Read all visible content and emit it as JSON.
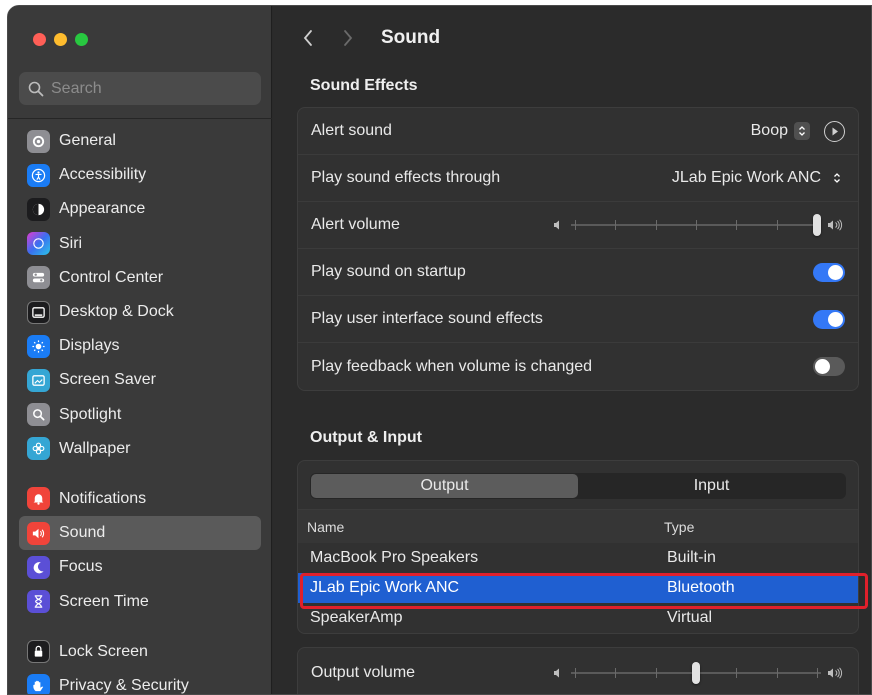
{
  "window": {
    "title": "Sound"
  },
  "search": {
    "placeholder": "Search"
  },
  "sidebar": {
    "items": [
      {
        "label": "General",
        "icon": "gear-icon",
        "color": "#8e8e93"
      },
      {
        "label": "Accessibility",
        "icon": "accessibility-icon",
        "color": "#1a7cf5"
      },
      {
        "label": "Appearance",
        "icon": "appearance-icon",
        "color": "#1c1c1e"
      },
      {
        "label": "Siri",
        "icon": "siri-icon",
        "color": "#6b3fd6"
      },
      {
        "label": "Control Center",
        "icon": "control-center-icon",
        "color": "#8e8e93"
      },
      {
        "label": "Desktop & Dock",
        "icon": "dock-icon",
        "color": "#1c1c1e"
      },
      {
        "label": "Displays",
        "icon": "sun-icon",
        "color": "#1a7cf5"
      },
      {
        "label": "Screen Saver",
        "icon": "screensaver-icon",
        "color": "#35a6d4"
      },
      {
        "label": "Spotlight",
        "icon": "magnifier-icon",
        "color": "#8e8e93"
      },
      {
        "label": "Wallpaper",
        "icon": "flower-icon",
        "color": "#35a6d4"
      },
      {
        "label": "Notifications",
        "icon": "bell-icon",
        "color": "#f0443a"
      },
      {
        "label": "Sound",
        "icon": "speaker-icon",
        "color": "#f0443a"
      },
      {
        "label": "Focus",
        "icon": "moon-icon",
        "color": "#5b4fd6"
      },
      {
        "label": "Screen Time",
        "icon": "hourglass-icon",
        "color": "#5b4fd6"
      },
      {
        "label": "Lock Screen",
        "icon": "lock-icon",
        "color": "#1c1c1e"
      },
      {
        "label": "Privacy & Security",
        "icon": "hand-icon",
        "color": "#1a7cf5"
      }
    ]
  },
  "sound_effects": {
    "title": "Sound Effects",
    "alert_sound": {
      "label": "Alert sound",
      "value": "Boop"
    },
    "play_through": {
      "label": "Play sound effects through",
      "value": "JLab Epic Work ANC"
    },
    "alert_volume": {
      "label": "Alert volume",
      "level": 1.0
    },
    "startup": {
      "label": "Play sound on startup",
      "on": true
    },
    "ui_effects": {
      "label": "Play user interface sound effects",
      "on": true
    },
    "feedback": {
      "label": "Play feedback when volume is changed",
      "on": false
    }
  },
  "output_input": {
    "title": "Output & Input",
    "tabs": [
      {
        "label": "Output",
        "active": true
      },
      {
        "label": "Input",
        "active": false
      }
    ],
    "columns": {
      "name": "Name",
      "type": "Type"
    },
    "devices": [
      {
        "name": "MacBook Pro Speakers",
        "type": "Built-in",
        "selected": false
      },
      {
        "name": "JLab Epic Work ANC",
        "type": "Bluetooth",
        "selected": true
      },
      {
        "name": "SpeakerAmp",
        "type": "Virtual",
        "selected": false
      }
    ]
  },
  "output_volume": {
    "label": "Output volume",
    "level": 0.5
  },
  "colors": {
    "accent": "#3478f6",
    "selection": "#1f5fd1",
    "highlight_box": "#e0202b"
  }
}
